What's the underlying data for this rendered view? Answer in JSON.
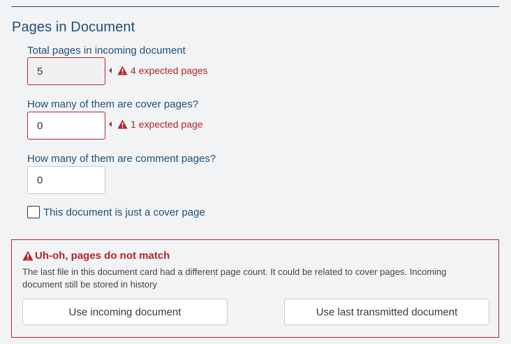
{
  "section": {
    "title": "Pages in Document"
  },
  "fields": {
    "total_pages": {
      "label": "Total pages in incoming document",
      "value": "5",
      "validation": "4 expected pages"
    },
    "cover_pages": {
      "label": "How many of them are cover pages?",
      "value": "0",
      "validation": "1 expected page"
    },
    "comment_pages": {
      "label": "How many of them are comment pages?",
      "value": "0"
    }
  },
  "checkbox": {
    "label": "This document is just a cover page",
    "checked": false
  },
  "alert": {
    "title": "Uh-oh, pages do not match",
    "message": "The last file in this document card had a different page count. It could be related to cover pages. Incoming document still be stored in history",
    "buttons": {
      "use_incoming": "Use incoming document",
      "use_last": "Use last transmitted document"
    }
  },
  "colors": {
    "accent": "#1d4f7a",
    "error": "#b3252d",
    "background": "#f2f3f4"
  }
}
